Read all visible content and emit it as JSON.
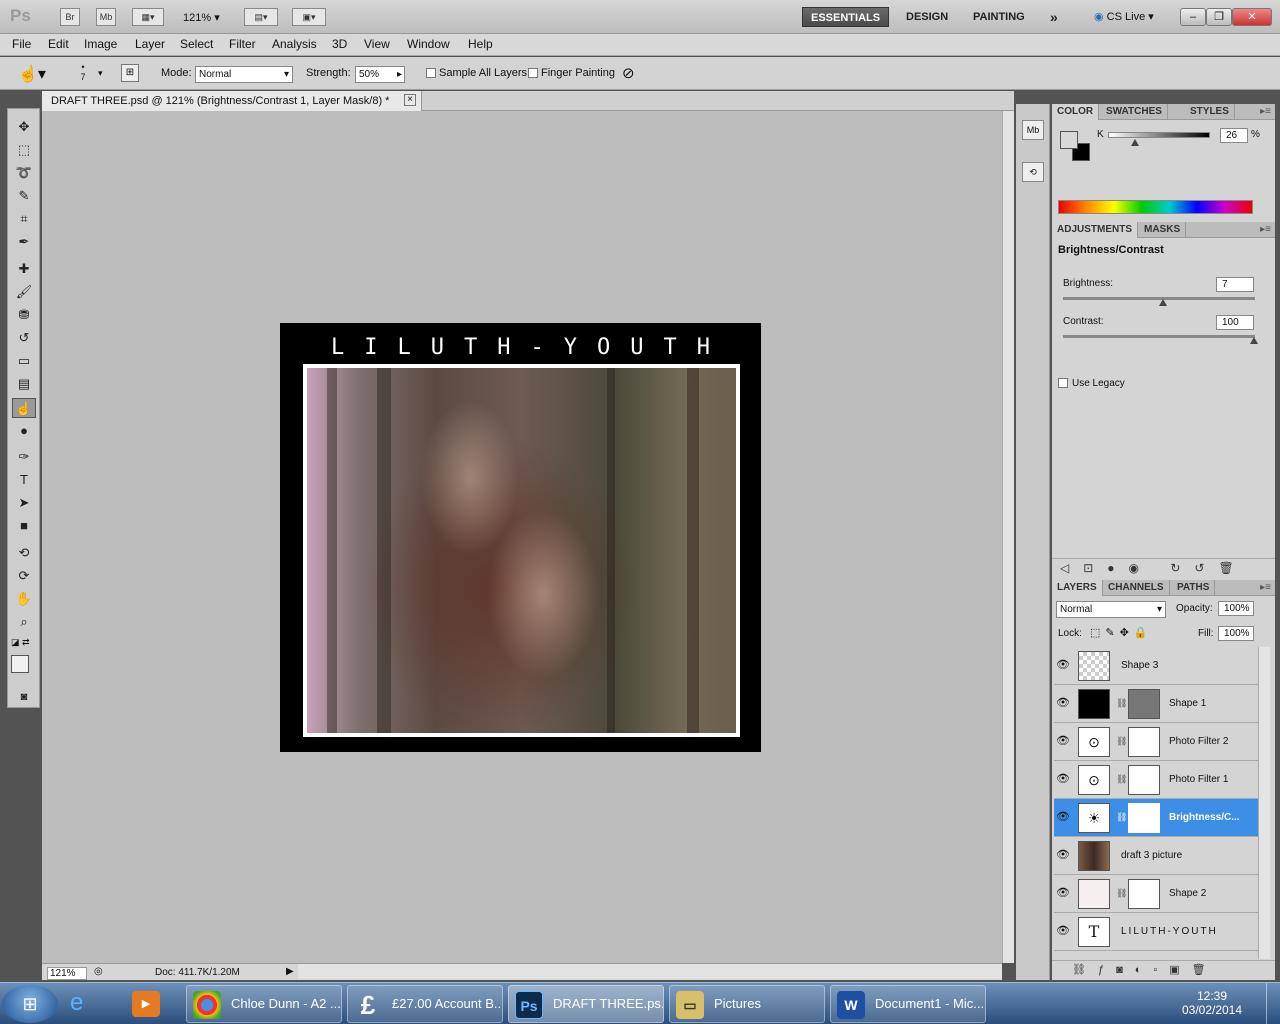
{
  "app": {
    "logo": "Ps",
    "bridge": "Br",
    "minibridge": "Mb",
    "zoom": "121%",
    "workspaces": [
      "ESSENTIALS",
      "DESIGN",
      "PAINTING"
    ],
    "more": "»",
    "cslive": "CS Live"
  },
  "menu": [
    "File",
    "Edit",
    "Image",
    "Layer",
    "Select",
    "Filter",
    "Analysis",
    "3D",
    "View",
    "Window",
    "Help"
  ],
  "options": {
    "brush_size": "7",
    "mode_label": "Mode:",
    "mode": "Normal",
    "strength_label": "Strength:",
    "strength": "50%",
    "sample_all": "Sample All Layers",
    "finger_painting": "Finger Painting"
  },
  "document": {
    "tab": "DRAFT THREE.psd @ 121% (Brightness/Contrast 1, Layer Mask/8) *",
    "close": "×",
    "artwork_title": "LILUTH-YOUTH"
  },
  "status": {
    "zoom": "121%",
    "doc": "Doc: 411.7K/1.20M"
  },
  "color_panel": {
    "tabs": [
      "COLOR",
      "SWATCHES",
      "STYLES"
    ],
    "channel": "K",
    "value": "26",
    "unit": "%",
    "level": 0.26
  },
  "adjustments": {
    "tabs": [
      "ADJUSTMENTS",
      "MASKS"
    ],
    "title": "Brightness/Contrast",
    "brightness_label": "Brightness:",
    "brightness": "7",
    "contrast_label": "Contrast:",
    "contrast": "100",
    "legacy": "Use Legacy"
  },
  "layers_panel": {
    "tabs": [
      "LAYERS",
      "CHANNELS",
      "PATHS"
    ],
    "blend": "Normal",
    "opacity_label": "Opacity:",
    "opacity": "100%",
    "lock_label": "Lock:",
    "fill_label": "Fill:",
    "fill": "100%",
    "layers": [
      {
        "name": "Shape 3"
      },
      {
        "name": "Shape 1"
      },
      {
        "name": "Photo Filter 2"
      },
      {
        "name": "Photo Filter 1"
      },
      {
        "name": "Brightness/C..."
      },
      {
        "name": "draft 3 picture"
      },
      {
        "name": "Shape 2"
      },
      {
        "name": "LILUTH-YOUTH"
      }
    ]
  },
  "taskbar": {
    "items": [
      "Chloe Dunn - A2 ...",
      "£27.00 Account B...",
      "DRAFT THREE.ps...",
      "Pictures",
      "Document1 - Mic..."
    ],
    "time": "12:39",
    "date": "03/02/2014"
  }
}
